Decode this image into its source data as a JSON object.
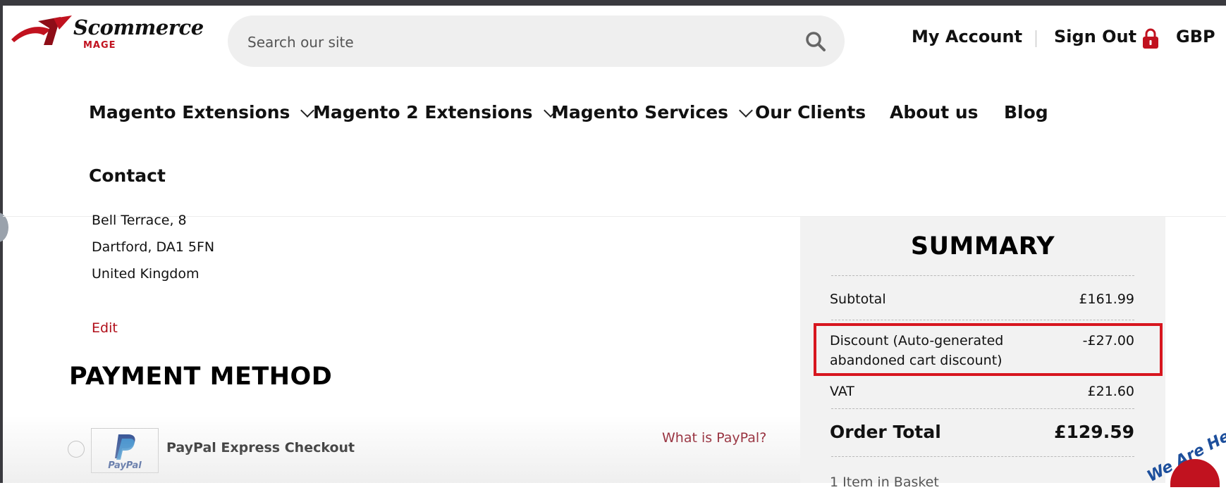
{
  "header": {
    "logo": {
      "brand": "Scommerce",
      "sub": "MAGE"
    },
    "search": {
      "placeholder": "Search our site"
    },
    "account_label": "My Account",
    "signout_label": "Sign Out",
    "currency_label": "GBP"
  },
  "nav": {
    "items": [
      {
        "label": "Magento Extensions",
        "has_dropdown": true
      },
      {
        "label": "Magento 2 Extensions",
        "has_dropdown": true
      },
      {
        "label": "Magento Services",
        "has_dropdown": true
      },
      {
        "label": "Our Clients",
        "has_dropdown": false
      },
      {
        "label": "About us",
        "has_dropdown": false
      },
      {
        "label": "Blog",
        "has_dropdown": false
      },
      {
        "label": "Contact",
        "has_dropdown": false
      }
    ]
  },
  "address": {
    "lines": [
      "Bell Terrace, 8",
      "Dartford, DA1 5FN",
      "United Kingdom"
    ],
    "edit_label": "Edit"
  },
  "payment": {
    "heading": "PAYMENT METHOD",
    "option_name": "PayPal Express Checkout",
    "logo_text": "PayPal",
    "what_is_label": "What is PayPal?"
  },
  "summary": {
    "title": "SUMMARY",
    "subtotal_label": "Subtotal",
    "subtotal_value": "£161.99",
    "discount_label_1": "Discount (Auto-generated",
    "discount_label_2": "abandoned cart discount)",
    "discount_value": "-£27.00",
    "vat_label": "VAT",
    "vat_value": "£21.60",
    "total_label": "Order Total",
    "total_value": "£129.59",
    "basket_label": "1 Item in Basket"
  },
  "widget": {
    "help_text": "We Are Here"
  },
  "colors": {
    "accent_red": "#d7161f",
    "link_red": "#b00d18",
    "summary_bg": "#f2f2f2"
  }
}
